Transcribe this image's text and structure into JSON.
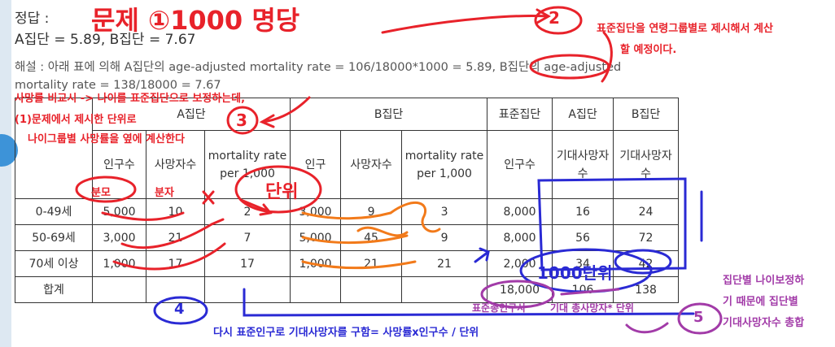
{
  "answer": {
    "title": "정답 :",
    "line": "A집단 = 5.89, B집단 = 7.67"
  },
  "explanation": "해설 : 아래 표에 의해 A집단의 age-adjusted mortality rate = 106/18000*1000 = 5.89, B집단의 age-adjusted mortality rate = 138/18000 = 7.67",
  "table": {
    "group_headers": [
      "A집단",
      "B집단",
      "표준집단",
      "A집단",
      "B집단"
    ],
    "sub_headers": [
      "인구수",
      "사망자수",
      "mortality rate per 1,000",
      "인구",
      "사망자수",
      "mortality rate per 1,000",
      "인구수",
      "기대사망자수",
      "기대사망자수"
    ],
    "rows": [
      {
        "label": "0-49세",
        "a_pop": "5,000",
        "a_deaths": "10",
        "a_rate": "2",
        "b_pop": "3,000",
        "b_deaths": "9",
        "b_rate": "3",
        "std_pop": "8,000",
        "a_exp": "16",
        "b_exp": "24"
      },
      {
        "label": "50-69세",
        "a_pop": "3,000",
        "a_deaths": "21",
        "a_rate": "7",
        "b_pop": "5,000",
        "b_deaths": "45",
        "b_rate": "9",
        "std_pop": "8,000",
        "a_exp": "56",
        "b_exp": "72"
      },
      {
        "label": "70세 이상",
        "a_pop": "1,000",
        "a_deaths": "17",
        "a_rate": "17",
        "b_pop": "1,000",
        "b_deaths": "21",
        "b_rate": "21",
        "std_pop": "2,000",
        "a_exp": "34",
        "b_exp": "42"
      }
    ],
    "total": {
      "label": "합계",
      "std_pop": "18,000",
      "a_exp": "106",
      "b_exp": "138"
    }
  },
  "annotations": {
    "title_hand": "문제 ①1000 명당",
    "circle_2": "2",
    "note_2_line1": "표준집단을 연령그룹별로 제시해서 계산",
    "note_2_line2": "할 예정이다.",
    "red_note1": "사망률 비교시 -> 나이를 표준집단으로 보정하는데,",
    "red_note2": "(1)문제에서 제시한 단위로",
    "red_note3": "나이그룹별 사망률을 옆에 계산한다",
    "circle_3": "3",
    "unit_hand": "단위",
    "bunmo": "분모",
    "bunja": "분자",
    "hand_1000_unit": "1000단위",
    "circle_4": "4",
    "blue_note": "다시 표준인구로 기대사망자를 구함= 사망률x인구수 / 단위",
    "std_total_label": "표준총인구사",
    "exp_total_label": "기대 총사망자* 단위",
    "circle_5": "5",
    "purple_line1": "집단별 나이보정하",
    "purple_line2": "기 때문에 집단별",
    "purple_line3": "기대사망자수 총합"
  },
  "colors": {
    "red_pen": "#e8222a",
    "blue_pen": "#2a2ad4",
    "orange_pen": "#f27a1a",
    "purple_pen": "#a23ba8",
    "sidebar_accent": "#3d93d8"
  }
}
